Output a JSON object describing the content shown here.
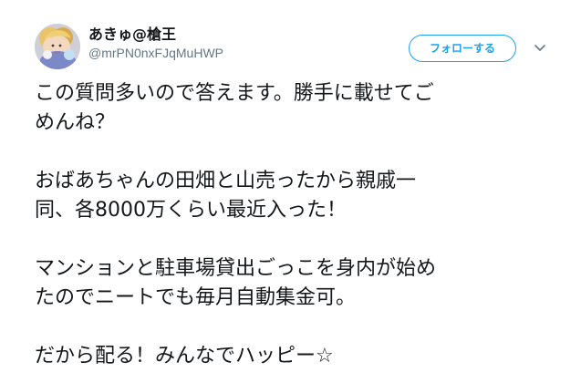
{
  "tweet": {
    "author": {
      "display_name": "あきゅ@槍王",
      "handle": "@mrPN0nxFJqMuHWP"
    },
    "follow_label": "フォローする",
    "text_lines": [
      "この質問多いので答えます。勝手に載せてご",
      "めんね？",
      "",
      "おばあちゃんの田畑と山売ったから親戚一",
      "同、各8000万くらい最近入った！",
      "",
      "マンションと駐車場貸出ごっこを身内が始め",
      "たのでニートでも毎月自動集金可。",
      "",
      "だから配る！みんなでハッピー☆"
    ]
  },
  "icons": {
    "more": "chevron-down-icon",
    "avatar": "avatar"
  },
  "colors": {
    "accent": "#1da1f2",
    "text": "#14171a",
    "secondary_text": "#657786",
    "background": "#ffffff"
  }
}
